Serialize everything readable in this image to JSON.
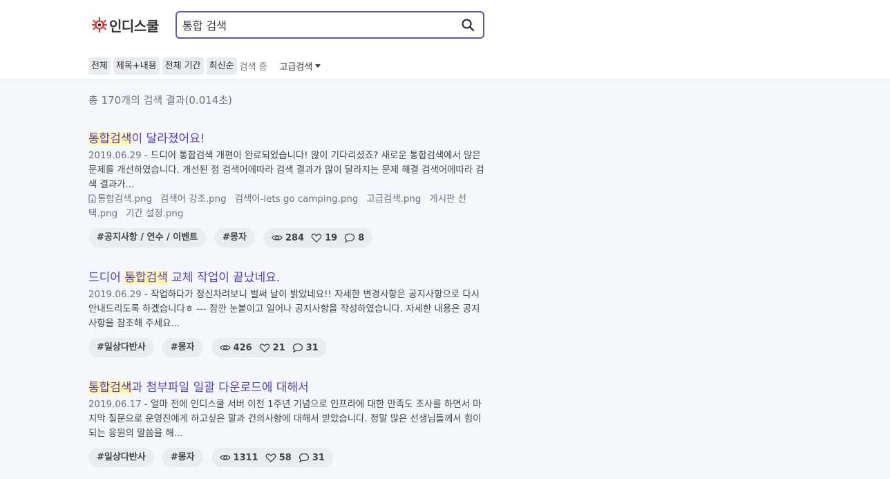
{
  "header": {
    "logo_text": "인디스쿨",
    "search_value": "통합 검색",
    "filters": [
      "전체",
      "제목+내용",
      "전체 기간",
      "최신순"
    ],
    "status": "검색 중",
    "advanced_label": "고급검색"
  },
  "summary": "총 170개의 검색 결과(0.014초)",
  "results": [
    {
      "title_hl": "통합검색",
      "title_rest": "이 달라졌어요!",
      "date": "2019.06.29",
      "snippet": " - 드디어 통합검색 개편이 완료되었습니다! 많이 기다리셨죠? 새로운 통합검색에서 많은 문제를 개선하였습니다.    개선된 점 검색어에따라 검색 결과가 많이 달라지는 문제 해결 검색어에따라 검색 결과가...",
      "files": [
        "통합검색.png",
        "검색어 강조.png",
        "검색어-lets go camping.png",
        "고급검색.png",
        "게시판 선택.png",
        "기간 설정.png"
      ],
      "tags": [
        "#공지사항 / 연수 / 이벤트",
        "#몽자"
      ],
      "views": "284",
      "likes": "19",
      "comments": "8"
    },
    {
      "title_pre": "드디어 ",
      "title_hl": "통합검색",
      "title_rest": " 교체 작업이 끝났네요.",
      "date": "2019.06.29",
      "snippet": " - 작업하다가 정신차려보니 벌써 날이 밝았네요!! 자세한 변경사항은 공지사항으로 다시 안내드리도록 하겠습니다ㅎ --- 잠깐 눈붙이고 일어나 공지사항을 작성하였습니다. 자세한 내용은 공지사항을 참조해 주세요...",
      "tags": [
        "#일상다반사",
        "#몽자"
      ],
      "views": "426",
      "likes": "21",
      "comments": "31"
    },
    {
      "title_hl": "통합검색",
      "title_rest": "과 첨부파일 일괄 다운로드에 대해서",
      "date": "2019.06.17",
      "snippet": " - 얼마 전에 인디스쿨 서버 이전 1주년 기념으로 인프라에 대한 만족도 조사를 하면서 마지막 질문으로 운영진에게 하고싶은 말과 건의사항에 대해서 받았습니다. 정말 많은 선생님들께서 힘이 되는 응원의 말씀을 해...",
      "tags": [
        "#일상다반사",
        "#몽자"
      ],
      "views": "1311",
      "likes": "58",
      "comments": "31"
    }
  ],
  "icons": {
    "logo": "indischool-logo-icon",
    "search": "search-icon",
    "caret": "caret-down-icon",
    "file": "file-icon",
    "views": "eye-icon",
    "likes": "heart-icon",
    "comments": "comment-icon"
  },
  "colors": {
    "accent": "#6a4fb8",
    "title": "#5b3fb3",
    "highlight": "#fff6b3",
    "logo_red": "#d8322a"
  }
}
